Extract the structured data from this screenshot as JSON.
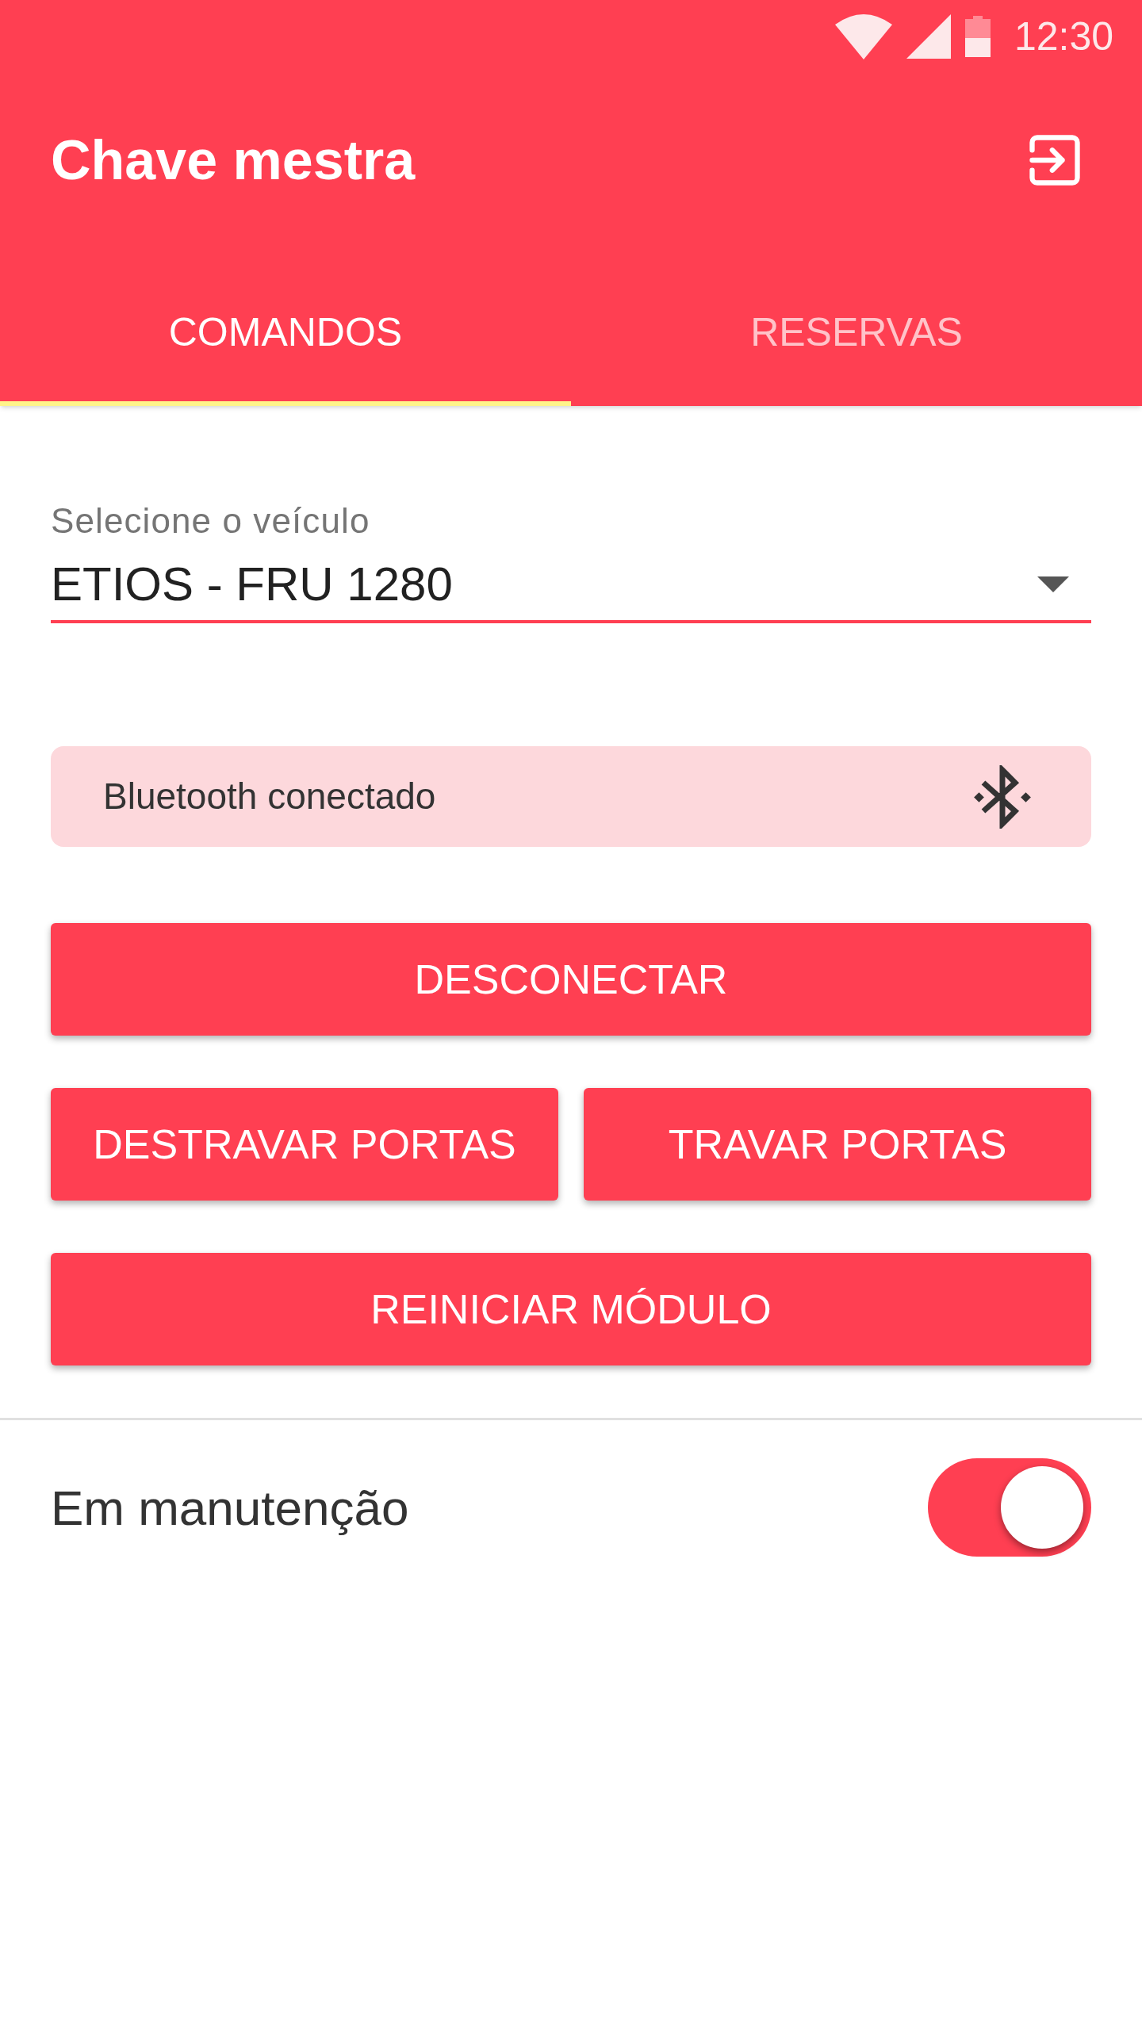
{
  "status_bar": {
    "time": "12:30"
  },
  "app_bar": {
    "title": "Chave mestra"
  },
  "tabs": [
    {
      "label": "COMANDOS",
      "selected": true
    },
    {
      "label": "RESERVAS",
      "selected": false
    }
  ],
  "vehicle_select": {
    "label": "Selecione o veículo",
    "value": "ETIOS - FRU 1280"
  },
  "bluetooth_status": {
    "text": "Bluetooth conectado",
    "connected": true
  },
  "buttons": [
    {
      "label": "DESCONECTAR",
      "kind": "full"
    },
    {
      "label": "DESTRAVAR PORTAS",
      "kind": "half"
    },
    {
      "label": "TRAVAR PORTAS",
      "kind": "half"
    },
    {
      "label": "REINICIAR MÓDULO",
      "kind": "full"
    }
  ],
  "maintenance": {
    "label": "Em manutenção",
    "on": true
  }
}
